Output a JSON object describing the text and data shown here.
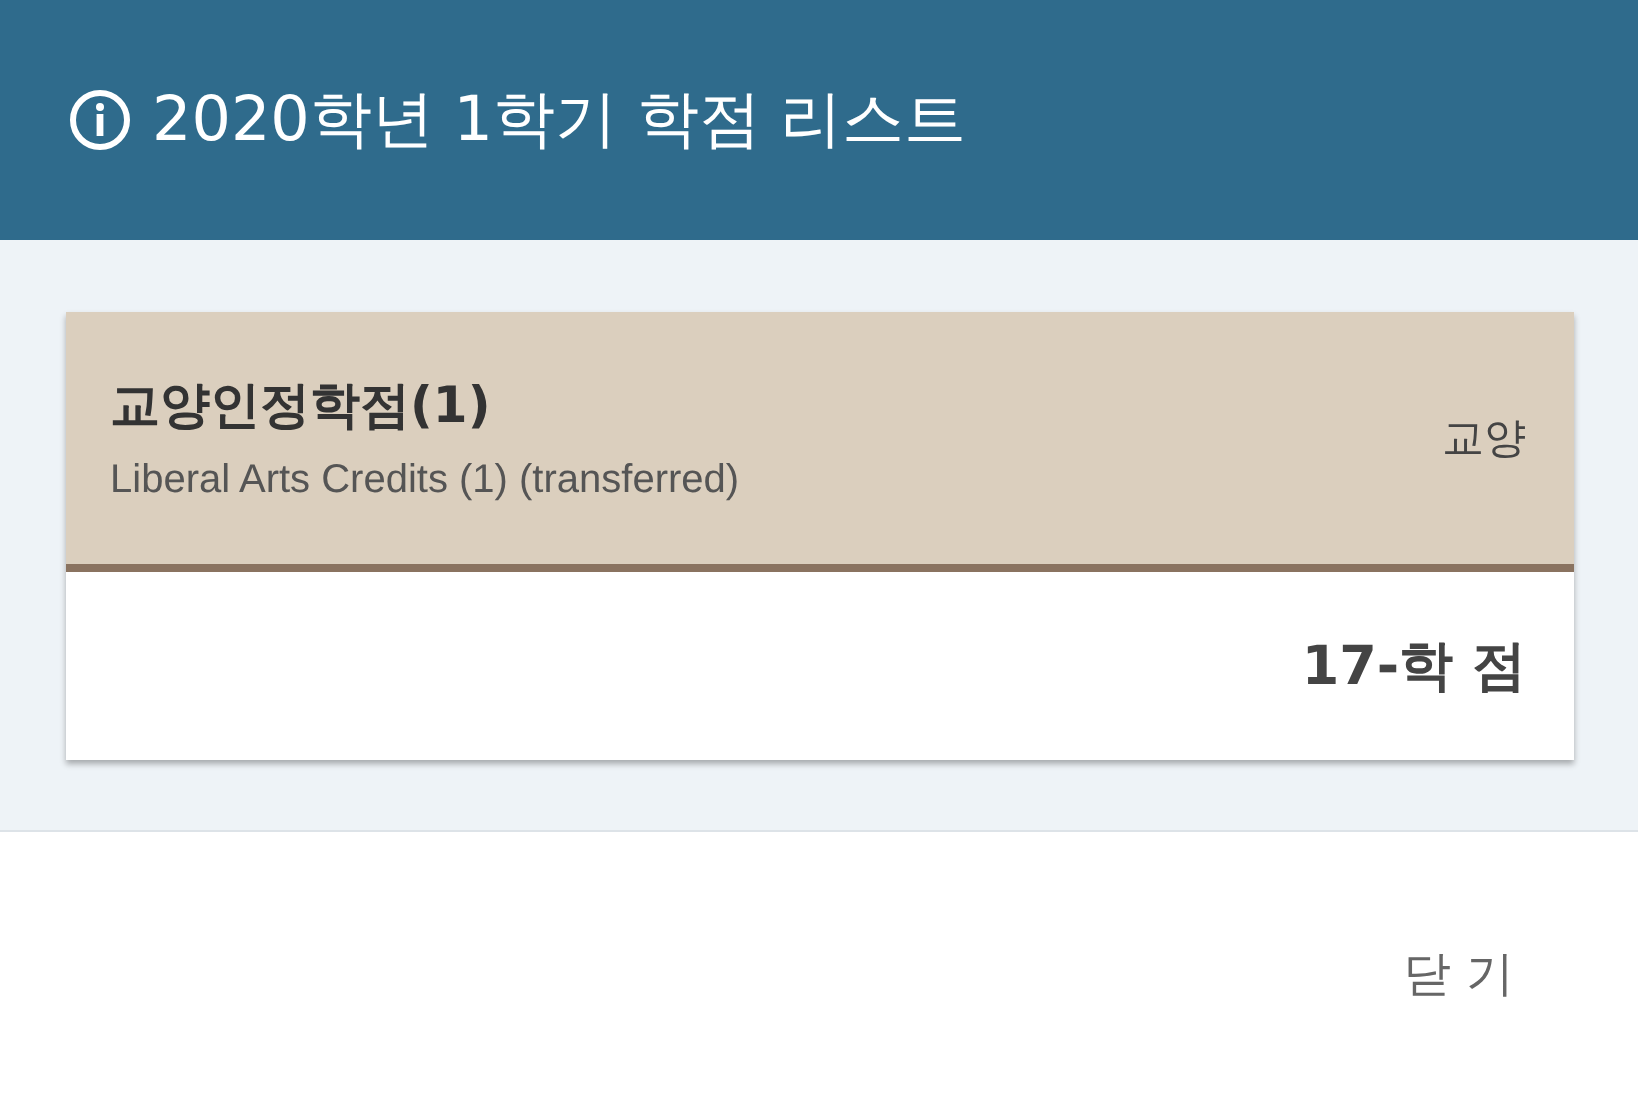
{
  "header": {
    "title": "2020학년 1학기 학점 리스트"
  },
  "courses": [
    {
      "name": "교양인정학점(1)",
      "subtitle": "Liberal Arts Credits (1) (transferred)",
      "category": "교양",
      "credits": "17-학 점"
    }
  ],
  "footer": {
    "close_button": "닫 기"
  }
}
